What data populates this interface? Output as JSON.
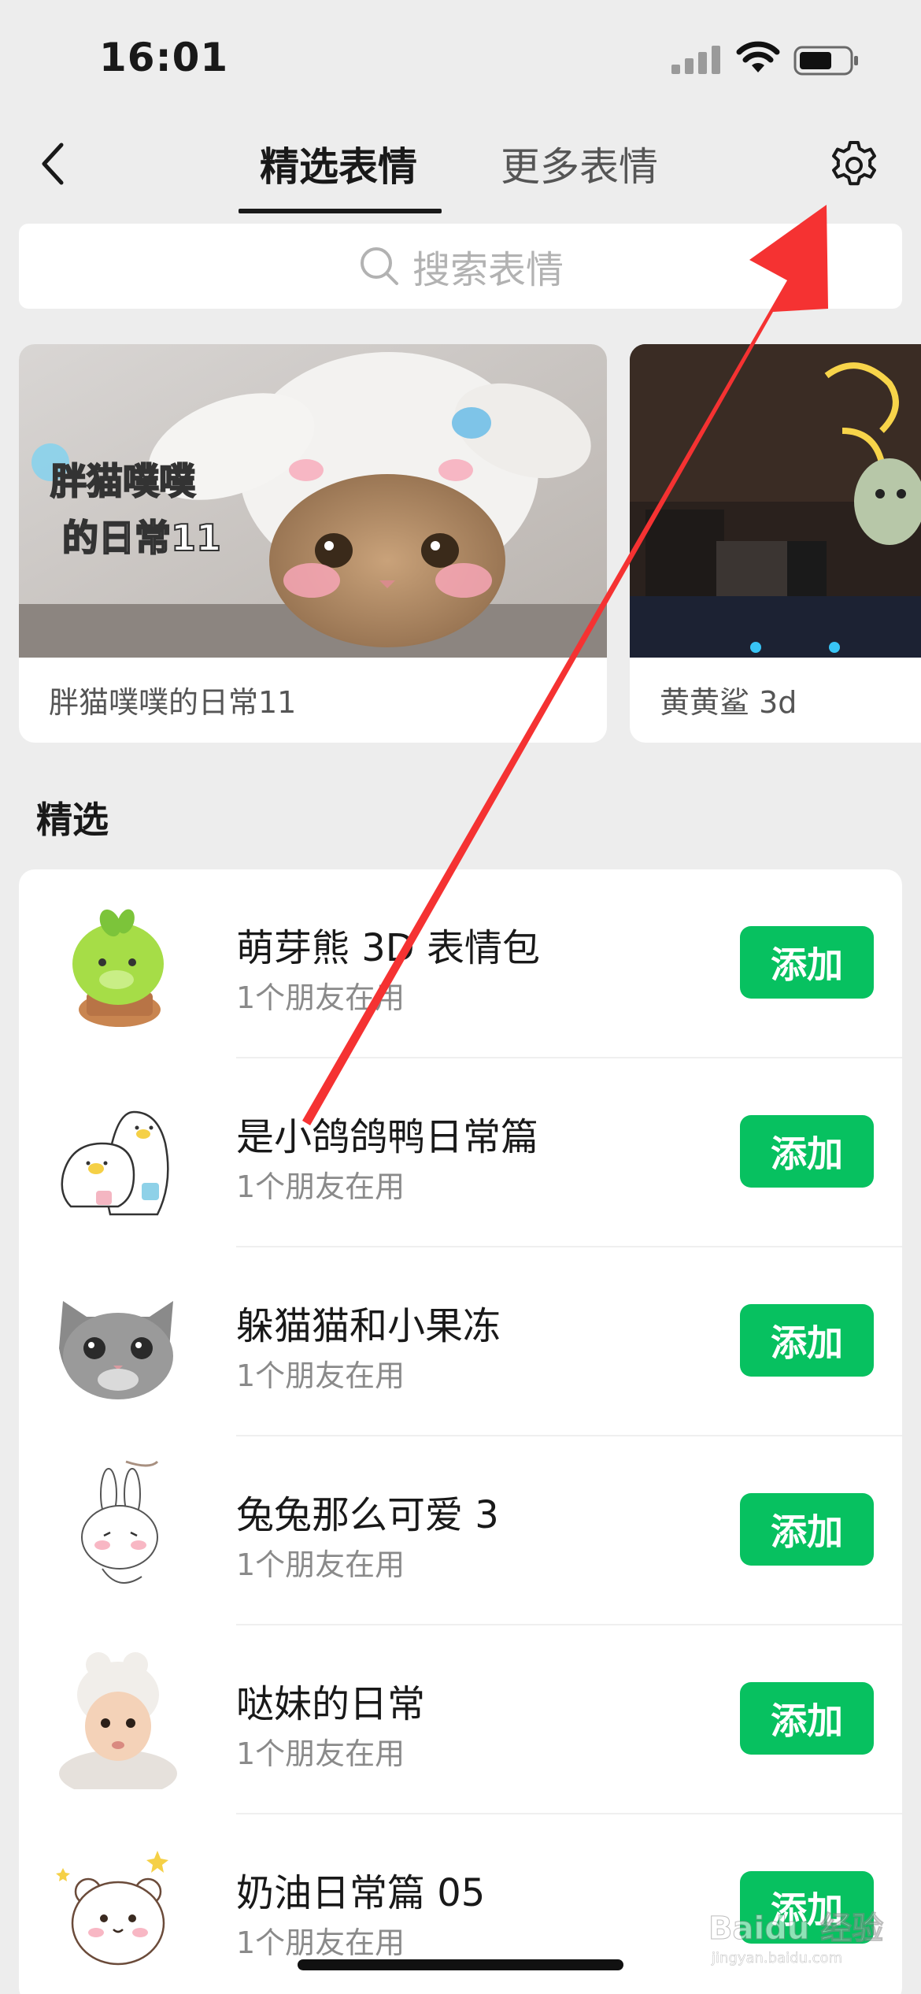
{
  "status_bar": {
    "time": "16:01"
  },
  "nav": {
    "tabs": [
      {
        "label": "精选表情",
        "active": true
      },
      {
        "label": "更多表情",
        "active": false
      }
    ]
  },
  "search": {
    "placeholder": "搜索表情"
  },
  "banners": [
    {
      "caption": "胖猫噗噗的日常11",
      "overlay_text_line1": "胖猫噗噗",
      "overlay_text_line2": "的日常11"
    },
    {
      "caption": "黄黄鲨 3d"
    }
  ],
  "section": {
    "title": "精选"
  },
  "packs": [
    {
      "title": "萌芽熊 3D 表情包",
      "subtitle": "1个朋友在用",
      "button": "添加"
    },
    {
      "title": "是小鸽鸽鸭日常篇",
      "subtitle": "1个朋友在用",
      "button": "添加"
    },
    {
      "title": "躲猫猫和小果冻",
      "subtitle": "1个朋友在用",
      "button": "添加"
    },
    {
      "title": "兔兔那么可爱 3",
      "subtitle": "1个朋友在用",
      "button": "添加"
    },
    {
      "title": "哒妹的日常",
      "subtitle": "1个朋友在用",
      "button": "添加"
    },
    {
      "title": "奶油日常篇 05",
      "subtitle": "1个朋友在用",
      "button": "添加"
    }
  ],
  "watermark": {
    "text": "Baidu 经验",
    "subtext": "jingyan.baidu.com"
  },
  "colors": {
    "accent_green": "#07C160",
    "arrow_red": "#F53232",
    "background": "#EDEDED"
  },
  "icons": [
    "signal-icon",
    "wifi-icon",
    "battery-icon",
    "back-icon",
    "gear-icon",
    "search-icon"
  ]
}
